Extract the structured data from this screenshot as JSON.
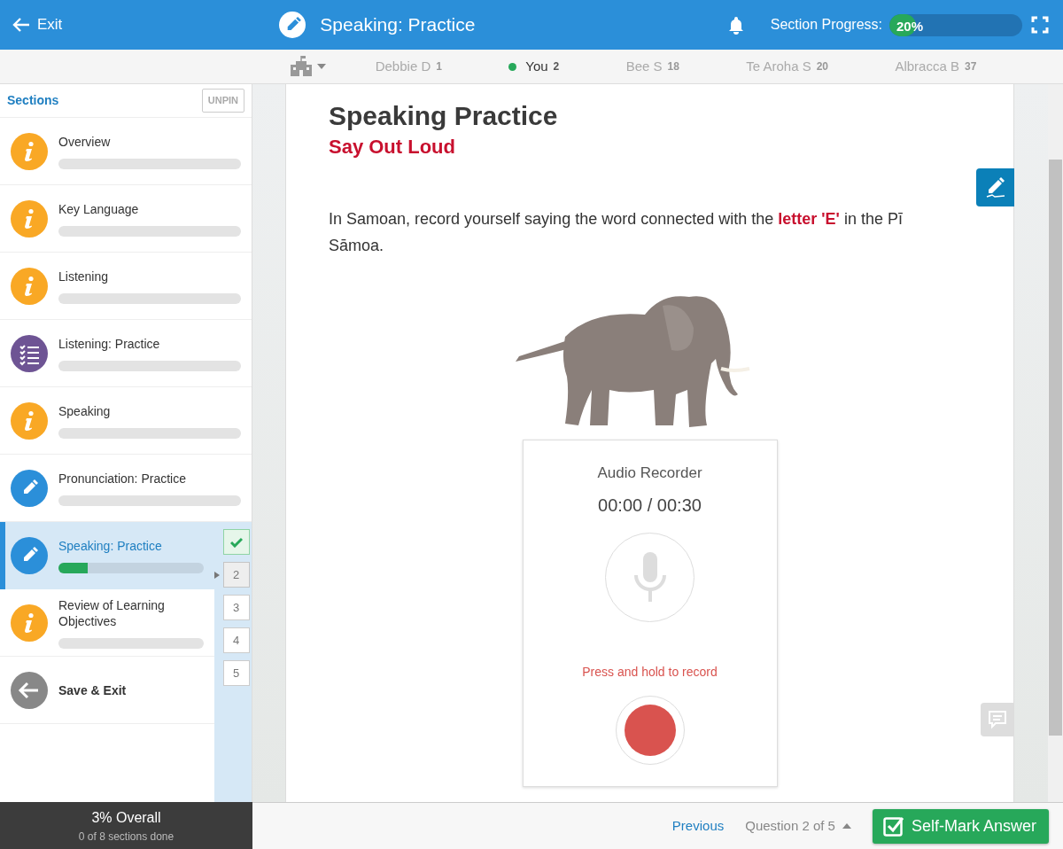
{
  "header": {
    "exit": "Exit",
    "title": "Speaking: Practice",
    "progress_label": "Section Progress:",
    "progress": {
      "level": 0.2,
      "reading": "20%"
    }
  },
  "leaderboard": [
    {
      "name": "Debbie D",
      "score": "1",
      "selected": false
    },
    {
      "name": "You",
      "score": "2",
      "selected": true
    },
    {
      "name": "Bee S",
      "score": "18",
      "selected": false
    },
    {
      "name": "Te Aroha S",
      "score": "20",
      "selected": false
    },
    {
      "name": "Albracca B",
      "score": "37",
      "selected": false
    }
  ],
  "sidebar": {
    "title": "Sections",
    "unpin": "UNPIN",
    "items": [
      {
        "kind": "info",
        "label": "Overview",
        "level": 0,
        "selected": false
      },
      {
        "kind": "info",
        "label": "Key Language",
        "level": 0,
        "selected": false
      },
      {
        "kind": "info",
        "label": "Listening",
        "level": 0,
        "selected": false
      },
      {
        "kind": "checklist",
        "label": "Listening: Practice",
        "level": 0,
        "selected": false
      },
      {
        "kind": "info",
        "label": "Speaking",
        "level": 0,
        "selected": false
      },
      {
        "kind": "pencil",
        "label": "Pronunciation: Practice",
        "level": 0,
        "selected": false
      },
      {
        "kind": "pencil",
        "label": "Speaking: Practice",
        "level": 0.2,
        "selected": true
      },
      {
        "kind": "info",
        "label": "Review of Learning Objectives",
        "level": 0,
        "selected": false
      },
      {
        "kind": "exit",
        "label": "Save & Exit",
        "selected": false
      }
    ],
    "questions": [
      {
        "done": true,
        "selected": false
      },
      {
        "label": "2",
        "done": false,
        "selected": true
      },
      {
        "label": "3",
        "done": false,
        "selected": false
      },
      {
        "label": "4",
        "done": false,
        "selected": false
      },
      {
        "label": "5",
        "done": false,
        "selected": false
      }
    ],
    "overall": {
      "title": "3% Overall",
      "subtitle": "0 of 8 sections done"
    }
  },
  "content": {
    "title": "Speaking Practice",
    "subtitle": "Say Out Loud",
    "prompt": "In Samoan, record yourself saying the word connected with the **letter 'E'** in the Pī Sāmoa.",
    "recorder": {
      "title": "Audio Recorder",
      "time": "00:00 / 00:30",
      "hint": "Press and hold to record"
    }
  },
  "footer": {
    "previous": "Previous",
    "question": "Question 2 of 5",
    "self_mark": "Self-Mark Answer"
  }
}
